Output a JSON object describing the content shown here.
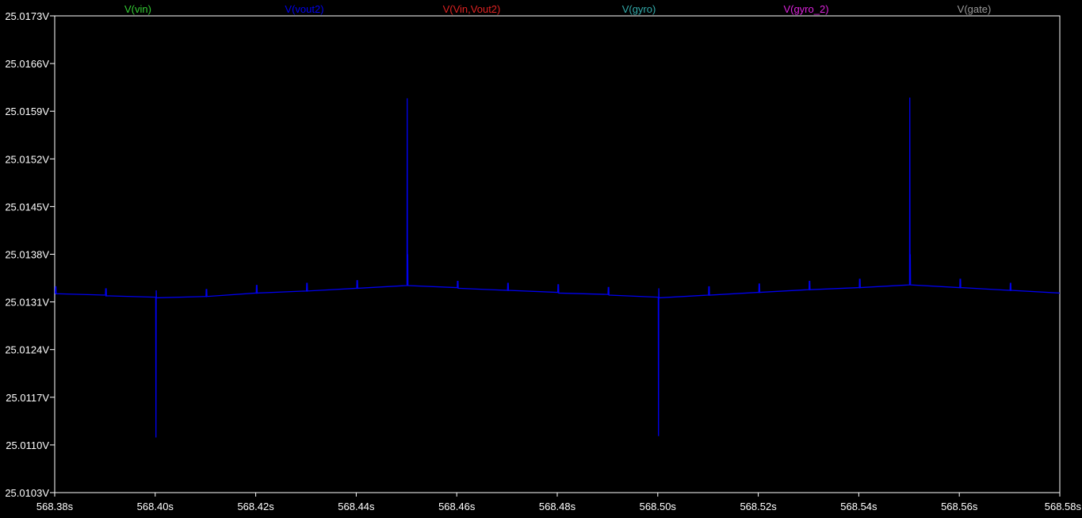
{
  "chart_data": {
    "type": "line",
    "title": "",
    "xlabel": "",
    "ylabel": "",
    "xlim": [
      568.38,
      568.58
    ],
    "ylim": [
      25.0103,
      25.0173
    ],
    "x_ticks": [
      "568.38s",
      "568.40s",
      "568.42s",
      "568.44s",
      "568.46s",
      "568.48s",
      "568.50s",
      "568.52s",
      "568.54s",
      "568.56s",
      "568.58s"
    ],
    "x_tick_values": [
      568.38,
      568.4,
      568.42,
      568.44,
      568.46,
      568.48,
      568.5,
      568.52,
      568.54,
      568.56,
      568.58
    ],
    "y_ticks": [
      "25.0173V",
      "25.0166V",
      "25.0159V",
      "25.0152V",
      "25.0145V",
      "25.0138V",
      "25.0131V",
      "25.0124V",
      "25.0117V",
      "25.0110V",
      "25.0103V"
    ],
    "y_tick_values": [
      25.0173,
      25.0166,
      25.0159,
      25.0152,
      25.0145,
      25.0138,
      25.0131,
      25.0124,
      25.0117,
      25.011,
      25.0103
    ],
    "grid": false,
    "legend_placement": "top",
    "series": [
      {
        "name": "V(vin)",
        "color": "#33cc33",
        "values": []
      },
      {
        "name": "V(vout2)",
        "color": "#0000ee",
        "x": [
          568.38,
          568.3801,
          568.38015,
          568.3802,
          568.38025,
          568.3803,
          568.39,
          568.3901,
          568.39015,
          568.3902,
          568.39025,
          568.3903,
          568.4,
          568.4001,
          568.40015,
          568.4002,
          568.40025,
          568.4003,
          568.41,
          568.4101,
          568.41015,
          568.4102,
          568.41025,
          568.4103,
          568.42,
          568.4201,
          568.42015,
          568.4202,
          568.42025,
          568.4203,
          568.43,
          568.4301,
          568.43015,
          568.4302,
          568.43025,
          568.4303,
          568.44,
          568.4401,
          568.44015,
          568.4402,
          568.44025,
          568.4403,
          568.45,
          568.4501,
          568.45015,
          568.4502,
          568.45025,
          568.4503,
          568.46,
          568.4601,
          568.46015,
          568.4602,
          568.46025,
          568.4603,
          568.47,
          568.4701,
          568.47015,
          568.4702,
          568.47025,
          568.4703,
          568.48,
          568.4801,
          568.48015,
          568.4802,
          568.48025,
          568.4803,
          568.49,
          568.4901,
          568.49015,
          568.4902,
          568.49025,
          568.4903,
          568.5,
          568.5001,
          568.50015,
          568.5002,
          568.50025,
          568.5003,
          568.51,
          568.5101,
          568.51015,
          568.5102,
          568.51025,
          568.5103,
          568.52,
          568.5201,
          568.52015,
          568.5202,
          568.52025,
          568.5203,
          568.53,
          568.5301,
          568.53015,
          568.5302,
          568.53025,
          568.5303,
          568.54,
          568.5401,
          568.54015,
          568.5402,
          568.54025,
          568.5403,
          568.55,
          568.5501,
          568.55015,
          568.5502,
          568.55025,
          568.5503,
          568.56,
          568.5601,
          568.56015,
          568.5602,
          568.56025,
          568.5603,
          568.57,
          568.5701,
          568.57015,
          568.5702,
          568.57025,
          568.5703,
          568.58
        ],
        "values": [
          25.01323,
          25.01323,
          25.01333,
          25.01321,
          25.01333,
          25.01322,
          25.0132,
          25.0132,
          25.0133,
          25.01318,
          25.0133,
          25.01319,
          25.01317,
          25.01317,
          25.01111,
          25.01327,
          25.01317,
          25.01316,
          25.01318,
          25.01318,
          25.01329,
          25.01317,
          25.01329,
          25.01318,
          25.01323,
          25.01323,
          25.01335,
          25.01322,
          25.01335,
          25.01323,
          25.01326,
          25.01326,
          25.01338,
          25.01325,
          25.01338,
          25.01326,
          25.0133,
          25.0133,
          25.01342,
          25.01329,
          25.01342,
          25.0133,
          25.01334,
          25.01334,
          25.01609,
          25.01336,
          25.0138,
          25.01334,
          25.01331,
          25.01331,
          25.01341,
          25.0133,
          25.01341,
          25.0133,
          25.01327,
          25.01327,
          25.01338,
          25.01326,
          25.01338,
          25.01327,
          25.01324,
          25.01324,
          25.01336,
          25.01323,
          25.01336,
          25.01323,
          25.01321,
          25.01321,
          25.01332,
          25.0132,
          25.01332,
          25.0132,
          25.01317,
          25.01317,
          25.01113,
          25.0133,
          25.01317,
          25.01316,
          25.0132,
          25.0132,
          25.01333,
          25.01319,
          25.01333,
          25.0132,
          25.01324,
          25.01324,
          25.01337,
          25.01323,
          25.01337,
          25.01324,
          25.01328,
          25.01328,
          25.01341,
          25.01327,
          25.01341,
          25.01328,
          25.01331,
          25.01331,
          25.01344,
          25.0133,
          25.01344,
          25.01331,
          25.01335,
          25.01335,
          25.0161,
          25.01337,
          25.0138,
          25.01335,
          25.01331,
          25.01331,
          25.01344,
          25.0133,
          25.01344,
          25.01331,
          25.01327,
          25.01327,
          25.01338,
          25.01326,
          25.01338,
          25.01327,
          25.01323
        ]
      },
      {
        "name": "V(Vin,Vout2)",
        "color": "#dd2222",
        "values": []
      },
      {
        "name": "V(gyro)",
        "color": "#33aaaa",
        "values": []
      },
      {
        "name": "V(gyro_2)",
        "color": "#dd22dd",
        "values": []
      },
      {
        "name": "V(gate)",
        "color": "#999999",
        "values": []
      }
    ]
  },
  "colors": {
    "background": "#000000",
    "frame": "#ffffff",
    "tick_label": "#ffffff"
  }
}
